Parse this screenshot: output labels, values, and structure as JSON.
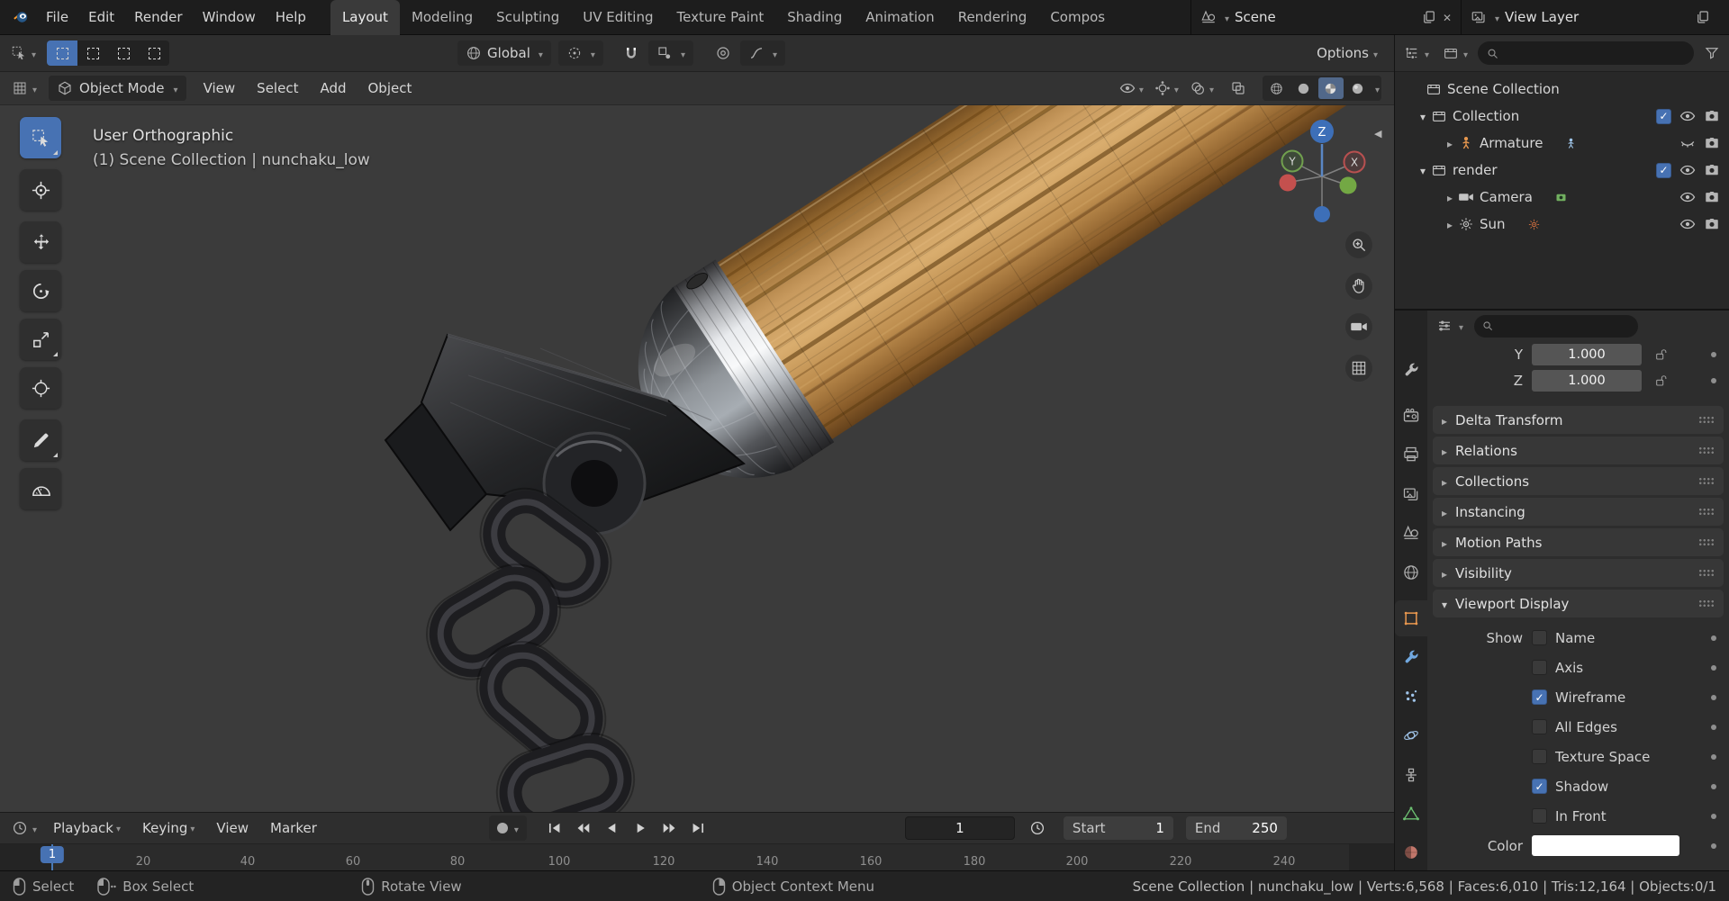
{
  "topbar": {
    "menus": [
      "File",
      "Edit",
      "Render",
      "Window",
      "Help"
    ],
    "workspaces": [
      "Layout",
      "Modeling",
      "Sculpting",
      "UV Editing",
      "Texture Paint",
      "Shading",
      "Animation",
      "Rendering",
      "Compos"
    ],
    "scene": {
      "label": "Scene"
    },
    "view_layer": {
      "label": "View Layer"
    }
  },
  "tool_settings": {
    "orientation": "Global",
    "options_label": "Options"
  },
  "viewport": {
    "mode": "Object Mode",
    "menus": [
      "View",
      "Select",
      "Add",
      "Object"
    ],
    "overlay": {
      "view_name": "User Orthographic",
      "context": "(1) Scene Collection | nunchaku_low"
    },
    "gizmo": {
      "z": "Z",
      "y": "Y",
      "x": "X"
    }
  },
  "outliner": {
    "rows": [
      {
        "label": "Scene Collection"
      },
      {
        "label": "Collection",
        "checked": true
      },
      {
        "label": "Armature"
      },
      {
        "label": "render",
        "checked": true
      },
      {
        "label": "Camera"
      },
      {
        "label": "Sun"
      }
    ]
  },
  "properties": {
    "transform": [
      {
        "axis": "Y",
        "value": "1.000"
      },
      {
        "axis": "Z",
        "value": "1.000"
      }
    ],
    "sections": [
      "Delta Transform",
      "Relations",
      "Collections",
      "Instancing",
      "Motion Paths",
      "Visibility",
      "Viewport Display"
    ],
    "viewport_display": {
      "show_label": "Show",
      "options": [
        {
          "label": "Name",
          "checked": false
        },
        {
          "label": "Axis",
          "checked": false
        },
        {
          "label": "Wireframe",
          "checked": true
        },
        {
          "label": "All Edges",
          "checked": false
        },
        {
          "label": "Texture Space",
          "checked": false
        },
        {
          "label": "Shadow",
          "checked": true
        },
        {
          "label": "In Front",
          "checked": false
        }
      ],
      "color_label": "Color",
      "color_value": "#ffffff"
    }
  },
  "timeline": {
    "menus": [
      "Playback",
      "Keying",
      "View",
      "Marker"
    ],
    "current_frame": "1",
    "playhead_frame": "1",
    "start_label": "Start",
    "start_value": "1",
    "end_label": "End",
    "end_value": "250",
    "ticks": [
      "20",
      "40",
      "60",
      "80",
      "100",
      "120",
      "140",
      "160",
      "180",
      "200",
      "220",
      "240"
    ]
  },
  "statusbar": {
    "hints": [
      "Select",
      "Box Select",
      "Rotate View",
      "Object Context Menu"
    ],
    "stats": "Scene Collection | nunchaku_low | Verts:6,568 | Faces:6,010 | Tris:12,164 | Objects:0/1"
  },
  "colors": {
    "accent": "#4772b3",
    "object_tab": "#e8974f",
    "modifier_tab": "#71a8e0",
    "data_tab": "#6cc071",
    "playhead": "#4772b3",
    "viewport_bg": "#3b3b3b"
  }
}
